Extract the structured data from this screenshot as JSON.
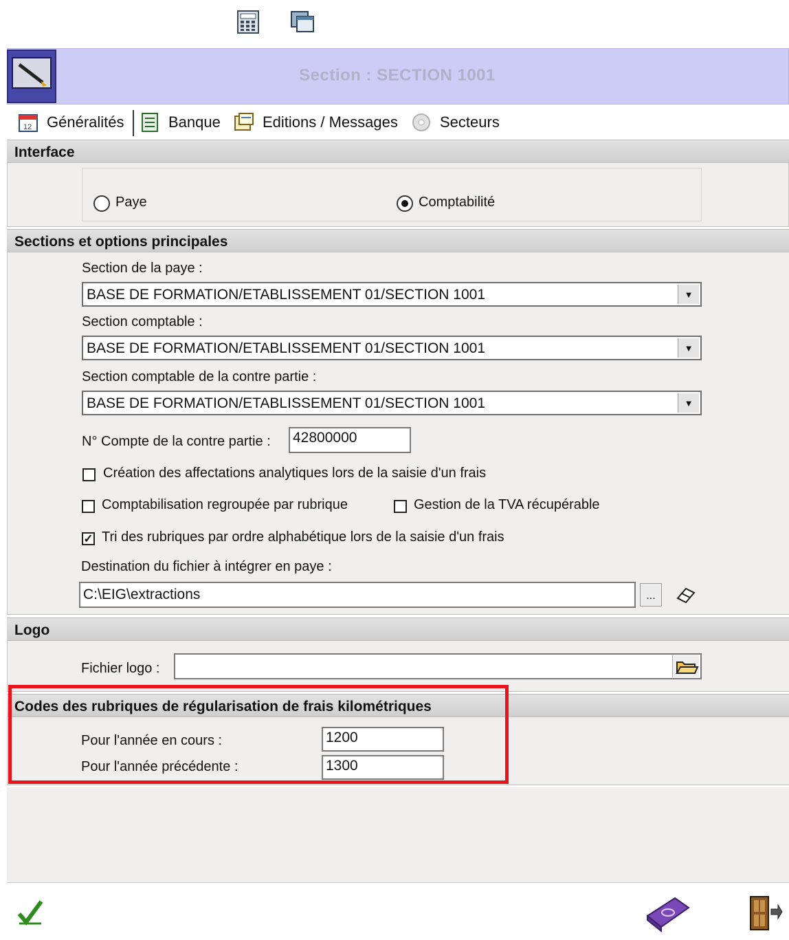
{
  "toolbar": {
    "icons": [
      "calculator-icon",
      "windows-icon"
    ]
  },
  "window": {
    "title": "Section : SECTION 1001"
  },
  "tabs": [
    {
      "label": "Généralités",
      "icon": "calendar-icon"
    },
    {
      "label": "Banque",
      "icon": "ledger-icon"
    },
    {
      "label": "Editions / Messages",
      "icon": "message-icon"
    },
    {
      "label": "Secteurs",
      "icon": "cd-icon"
    }
  ],
  "interface": {
    "heading": "Interface",
    "options": [
      {
        "label": "Paye",
        "selected": false
      },
      {
        "label": "Comptabilité",
        "selected": true
      }
    ]
  },
  "sections": {
    "heading": "Sections et options principales",
    "paye_label": "Section de la paye :",
    "paye_value": "BASE DE FORMATION/ETABLISSEMENT 01/SECTION 1001",
    "compta_label": "Section comptable :",
    "compta_value": "BASE DE FORMATION/ETABLISSEMENT 01/SECTION 1001",
    "contre_label": "Section comptable de la contre partie :",
    "contre_value": "BASE DE FORMATION/ETABLISSEMENT 01/SECTION 1001",
    "compte_label": "N° Compte de la contre partie :",
    "compte_value": "42800000",
    "checkboxes": [
      {
        "label": "Création des affectations analytiques lors de la saisie d'un frais",
        "checked": false
      },
      {
        "label": "Comptabilisation regroupée par rubrique",
        "checked": false
      },
      {
        "label": "Gestion de la TVA récupérable",
        "checked": false
      },
      {
        "label": "Tri des rubriques par ordre alphabétique lors de la saisie d'un frais",
        "checked": true
      }
    ],
    "destination_label": "Destination du fichier à intégrer en paye :",
    "destination_value": "C:\\EIG\\extractions",
    "browse_label": "..."
  },
  "logo": {
    "heading": "Logo",
    "file_label": "Fichier logo :",
    "file_value": ""
  },
  "codes": {
    "heading": "Codes des rubriques de régularisation de frais kilométriques",
    "current_label": "Pour l'année en cours  :",
    "current_value": "1200",
    "previous_label": "Pour l'année précédente  :",
    "previous_value": "1300",
    "highlight_color": "#e8141c"
  },
  "footer": {
    "icons": [
      "validate-icon",
      "help-book-icon",
      "exit-door-icon"
    ]
  }
}
